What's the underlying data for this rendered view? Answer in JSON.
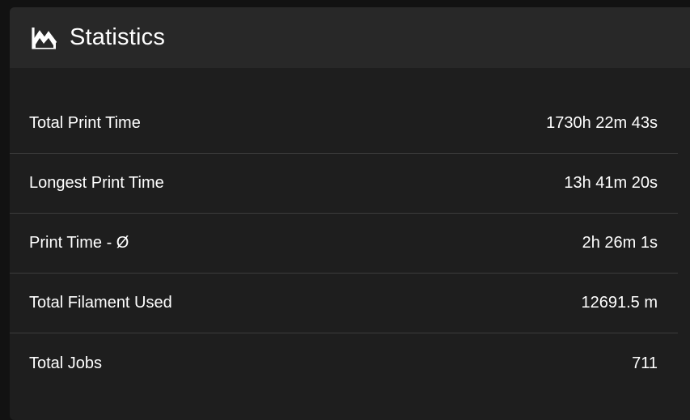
{
  "card": {
    "title": "Statistics",
    "icon": "chart-line-icon"
  },
  "stats": [
    {
      "label": "Total Print Time",
      "value": "1730h 22m 43s"
    },
    {
      "label": "Longest Print Time",
      "value": "13h 41m 20s"
    },
    {
      "label": "Print Time - Ø",
      "value": "2h 26m 1s"
    },
    {
      "label": "Total Filament Used",
      "value": "12691.5 m"
    },
    {
      "label": "Total Jobs",
      "value": "711"
    }
  ],
  "colors": {
    "page_background": "#121212",
    "card_background": "#1e1e1e",
    "header_background": "#282828",
    "divider": "#3c3c3c",
    "text": "#ffffff"
  }
}
